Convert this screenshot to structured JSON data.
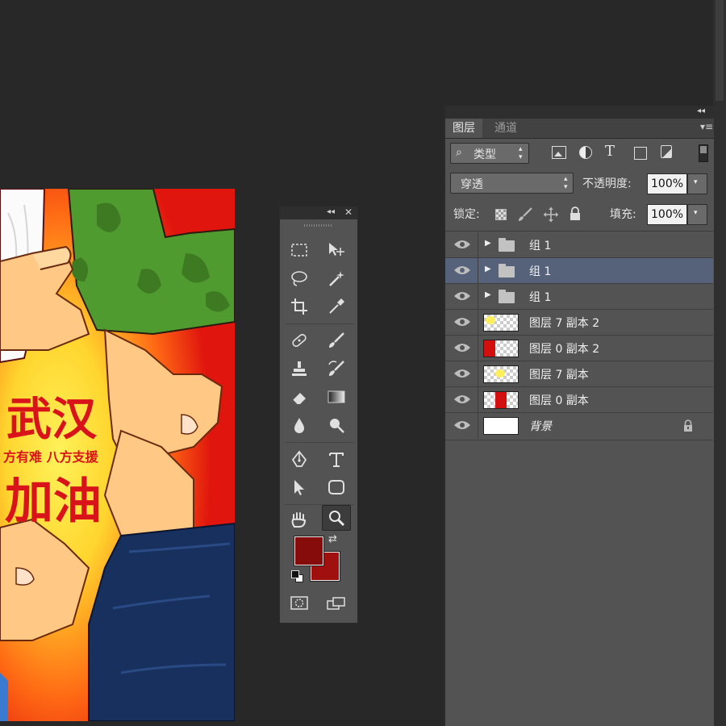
{
  "layers_panel": {
    "tabs": [
      {
        "label": "图层",
        "selected": true
      },
      {
        "label": "通道",
        "selected": false
      }
    ],
    "filter_kind": "类型",
    "blend_mode": "穿透",
    "opacity_label": "不透明度:",
    "opacity_value": "100%",
    "lock_label": "锁定:",
    "fill_label": "填充:",
    "fill_value": "100%",
    "layers": [
      {
        "name": "组 1",
        "type": "group",
        "selected": false
      },
      {
        "name": "组 1",
        "type": "group",
        "selected": true
      },
      {
        "name": "组 1",
        "type": "group",
        "selected": false
      },
      {
        "name": "图层 7 副本 2",
        "type": "layer",
        "thumb": "yellow"
      },
      {
        "name": "图层 0 副本 2",
        "type": "layer",
        "thumb": "red"
      },
      {
        "name": "图层 7 副本",
        "type": "layer",
        "thumb": "yellow"
      },
      {
        "name": "图层 0 副本",
        "type": "layer",
        "thumb": "red"
      },
      {
        "name": "背景",
        "type": "background",
        "locked": true
      }
    ]
  },
  "canvas_text": {
    "line1": "武汉",
    "line2": "方有难  八方支援",
    "line3": "加油"
  },
  "colors": {
    "foreground": "#860b0b",
    "background": "#a0100f",
    "selection": "#56627a",
    "panel": "#535353",
    "workspace": "#282828"
  },
  "tools": [
    "rectangular-marquee",
    "move",
    "lasso",
    "magic-wand",
    "crop",
    "eyedropper",
    "spot-healing",
    "brush",
    "clone-stamp",
    "history-brush",
    "eraser",
    "gradient",
    "blur",
    "dodge",
    "pen",
    "type",
    "path-selection",
    "rectangle",
    "hand",
    "zoom"
  ]
}
